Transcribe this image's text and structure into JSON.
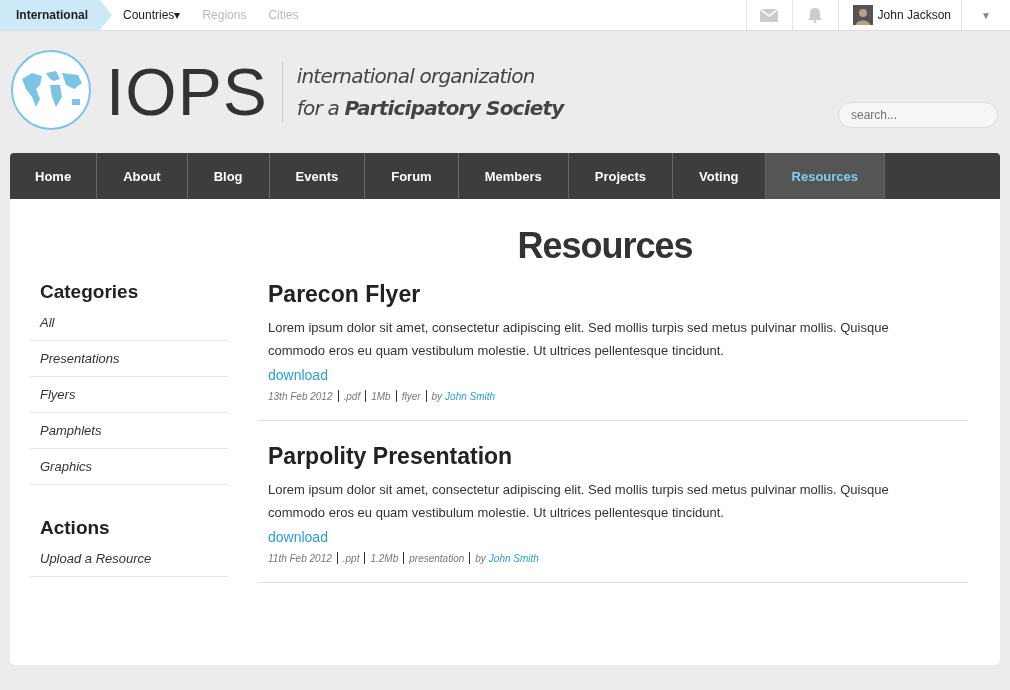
{
  "top_bar": {
    "scopes": [
      {
        "label": "International",
        "selected": true,
        "disabled": false
      },
      {
        "label": "Countries▾",
        "selected": false,
        "disabled": false
      },
      {
        "label": "Regions",
        "selected": false,
        "disabled": true
      },
      {
        "label": "Cities",
        "selected": false,
        "disabled": true
      }
    ],
    "user": {
      "name": "John Jackson",
      "menu": "▼"
    }
  },
  "header": {
    "logo_text": "IOPS",
    "tagline": [
      "international organization",
      "for a **Participatory Society**"
    ],
    "search": {
      "placeholder": "search..."
    }
  },
  "nav": [
    {
      "label": "Home",
      "selected": false
    },
    {
      "label": "About",
      "selected": false
    },
    {
      "label": "Blog",
      "selected": false
    },
    {
      "label": "Events",
      "selected": false
    },
    {
      "label": "Forum",
      "selected": false
    },
    {
      "label": "Members",
      "selected": false
    },
    {
      "label": "Projects",
      "selected": false
    },
    {
      "label": "Voting",
      "selected": false
    },
    {
      "label": "Resources",
      "selected": true
    }
  ],
  "page_title": "Resources",
  "sidebar": [
    {
      "heading": "Categories",
      "items": [
        "All",
        "Presentations",
        "Flyers",
        "Pamphlets",
        "Graphics"
      ]
    },
    {
      "heading": "Actions",
      "items": [
        "Upload a Resource"
      ]
    }
  ],
  "resources": [
    {
      "title": "Parecon Flyer",
      "text": "Lorem ipsum dolor sit amet, consectetur adipiscing elit. Sed mollis turpis sed metus pulvinar mollis. Quisque commodo eros eu quam vestibulum molestie. Ut ultrices pellentesque tincidunt.",
      "link": "download",
      "meta": [
        "13th Feb 2012",
        ".pdf",
        "1Mb",
        "flyer"
      ],
      "by": "by",
      "author": "John Smith"
    },
    {
      "title": "Parpolity Presentation",
      "text": "Lorem ipsum dolor sit amet, consectetur adipiscing elit. Sed mollis turpis sed metus pulvinar mollis. Quisque commodo eros eu quam vestibulum molestie. Ut ultrices pellentesque tincidunt.",
      "link": "download",
      "meta": [
        "11th Feb 2012",
        ".ppt",
        "1.2Mb",
        "presentation"
      ],
      "by": "by",
      "author": "John Smith"
    }
  ]
}
